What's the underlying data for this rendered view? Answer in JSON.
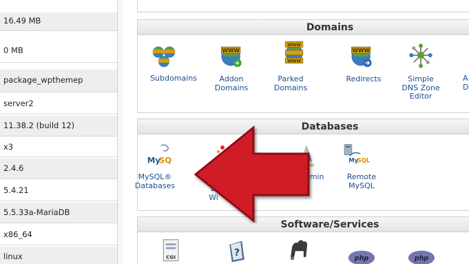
{
  "stats": [
    {
      "value": "16.49 MB",
      "shade": true
    },
    {
      "value": "0 MB",
      "shade": false
    },
    {
      "value": "package_wpthemep",
      "shade": true
    },
    {
      "value": "server2",
      "shade": false
    },
    {
      "value": "11.38.2 (build 12)",
      "shade": true
    },
    {
      "value": "x3",
      "shade": false
    },
    {
      "value": "2.4.6",
      "shade": true
    },
    {
      "value": "5.4.21",
      "shade": false
    },
    {
      "value": "5.5.33a-MariaDB",
      "shade": true
    },
    {
      "value": "x86_64",
      "shade": false
    },
    {
      "value": "linux",
      "shade": true
    }
  ],
  "domains": {
    "title": "Domains",
    "items": [
      {
        "label": "Subdomains",
        "icon": "subdomains-icon"
      },
      {
        "label": "Addon\nDomains",
        "icon": "addon-domains-icon"
      },
      {
        "label": "Parked\nDomains",
        "icon": "parked-domains-icon"
      },
      {
        "label": "Redirects",
        "icon": "redirects-icon"
      },
      {
        "label": "Simple\nDNS Zone\nEditor",
        "icon": "dns-zone-editor-icon"
      },
      {
        "label": "A\nD",
        "icon": "advanced-dns-icon"
      }
    ],
    "www_text": "WWW"
  },
  "databases": {
    "title": "Databases",
    "items": [
      {
        "label": "MySQL®\nDatabases",
        "icon": "mysql-databases-icon"
      },
      {
        "label": "D\nWi",
        "icon": "mysql-wizard-icon"
      },
      {
        "label": "Admin",
        "icon": "phpmyadmin-icon"
      },
      {
        "label": "Remote\nMySQL",
        "icon": "remote-mysql-icon"
      }
    ],
    "mysql_logo": "MySQL",
    "pma_logo": "min"
  },
  "software": {
    "title": "Software/Services",
    "cgi_text": "CGI",
    "php_text": "php"
  },
  "colors": {
    "arrow": "#d01f26",
    "link": "#1a4d8f",
    "www_gold": "#d4a017"
  }
}
